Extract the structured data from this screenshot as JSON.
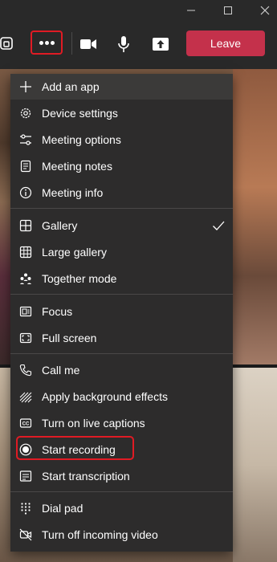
{
  "window": {
    "controls": [
      "minimize-icon",
      "maximize-icon",
      "close-icon"
    ]
  },
  "toolbar": {
    "buttons": [
      "share-tray-icon",
      "more-actions-icon",
      "camera-icon",
      "microphone-icon",
      "share-content-icon"
    ],
    "leave_label": "Leave",
    "leave_color": "#c4314b",
    "highlight_color": "#e01b24"
  },
  "menu": {
    "groups": [
      {
        "items": [
          {
            "label": "Add an app",
            "icon": "plus-icon"
          },
          {
            "label": "Device settings",
            "icon": "gear-icon"
          },
          {
            "label": "Meeting options",
            "icon": "sliders-icon"
          },
          {
            "label": "Meeting notes",
            "icon": "notes-icon"
          },
          {
            "label": "Meeting info",
            "icon": "info-icon"
          }
        ]
      },
      {
        "items": [
          {
            "label": "Gallery",
            "icon": "grid-icon",
            "checked": true
          },
          {
            "label": "Large gallery",
            "icon": "large-grid-icon"
          },
          {
            "label": "Together mode",
            "icon": "people-icon"
          }
        ]
      },
      {
        "items": [
          {
            "label": "Focus",
            "icon": "focus-icon"
          },
          {
            "label": "Full screen",
            "icon": "fullscreen-icon"
          }
        ]
      },
      {
        "items": [
          {
            "label": "Call me",
            "icon": "phone-icon"
          },
          {
            "label": "Apply background effects",
            "icon": "background-effects-icon"
          },
          {
            "label": "Turn on live captions",
            "icon": "captions-icon"
          },
          {
            "label": "Start recording",
            "icon": "record-icon",
            "highlighted_box": true
          },
          {
            "label": "Start transcription",
            "icon": "transcript-icon"
          }
        ]
      },
      {
        "items": [
          {
            "label": "Dial pad",
            "icon": "dialpad-icon"
          },
          {
            "label": "Turn off incoming video",
            "icon": "video-off-icon"
          }
        ]
      }
    ]
  }
}
